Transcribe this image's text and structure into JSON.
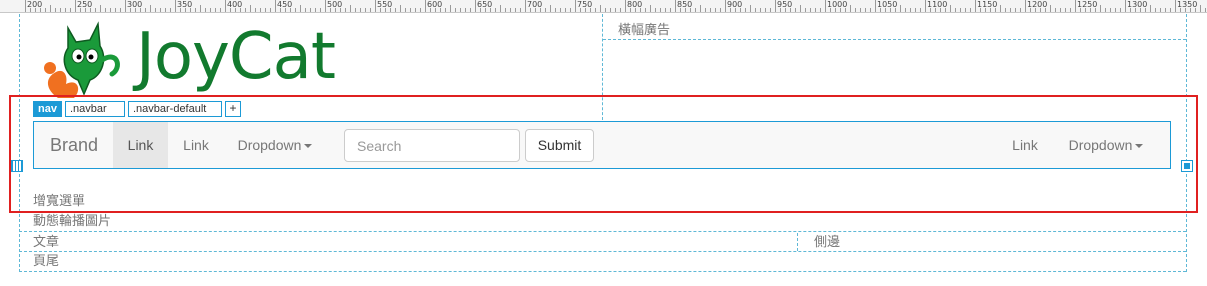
{
  "ruler": {
    "labels": [
      "200",
      "250",
      "300",
      "350",
      "400",
      "450",
      "500",
      "550",
      "600",
      "650",
      "700",
      "750",
      "800",
      "850",
      "900",
      "950",
      "1000",
      "1050",
      "1100",
      "1150",
      "1200",
      "1250",
      "1300",
      "1350"
    ]
  },
  "regions": {
    "banner_ad": "橫幅廣告",
    "mega_menu": "增寬選單",
    "carousel": "動態輪播圖片",
    "article": "文章",
    "sidebar": "側邊",
    "footer": "頁尾"
  },
  "logo": {
    "text": "JoyCat",
    "brand_color": "#127a2e",
    "mascot_icon": "cat-mascot-icon"
  },
  "selector": {
    "tag": "nav",
    "classes": [
      ".navbar",
      ".navbar-default"
    ],
    "add_label": "+"
  },
  "navbar": {
    "brand": "Brand",
    "left_links": [
      {
        "label": "Link",
        "active": true
      },
      {
        "label": "Link",
        "active": false
      }
    ],
    "left_dropdown": "Dropdown",
    "search_placeholder": "Search",
    "submit_label": "Submit",
    "right_link": "Link",
    "right_dropdown": "Dropdown"
  },
  "colors": {
    "selection_border": "#e02020",
    "selection_accent": "#1c9ad6",
    "guide": "#5fb8d6"
  }
}
